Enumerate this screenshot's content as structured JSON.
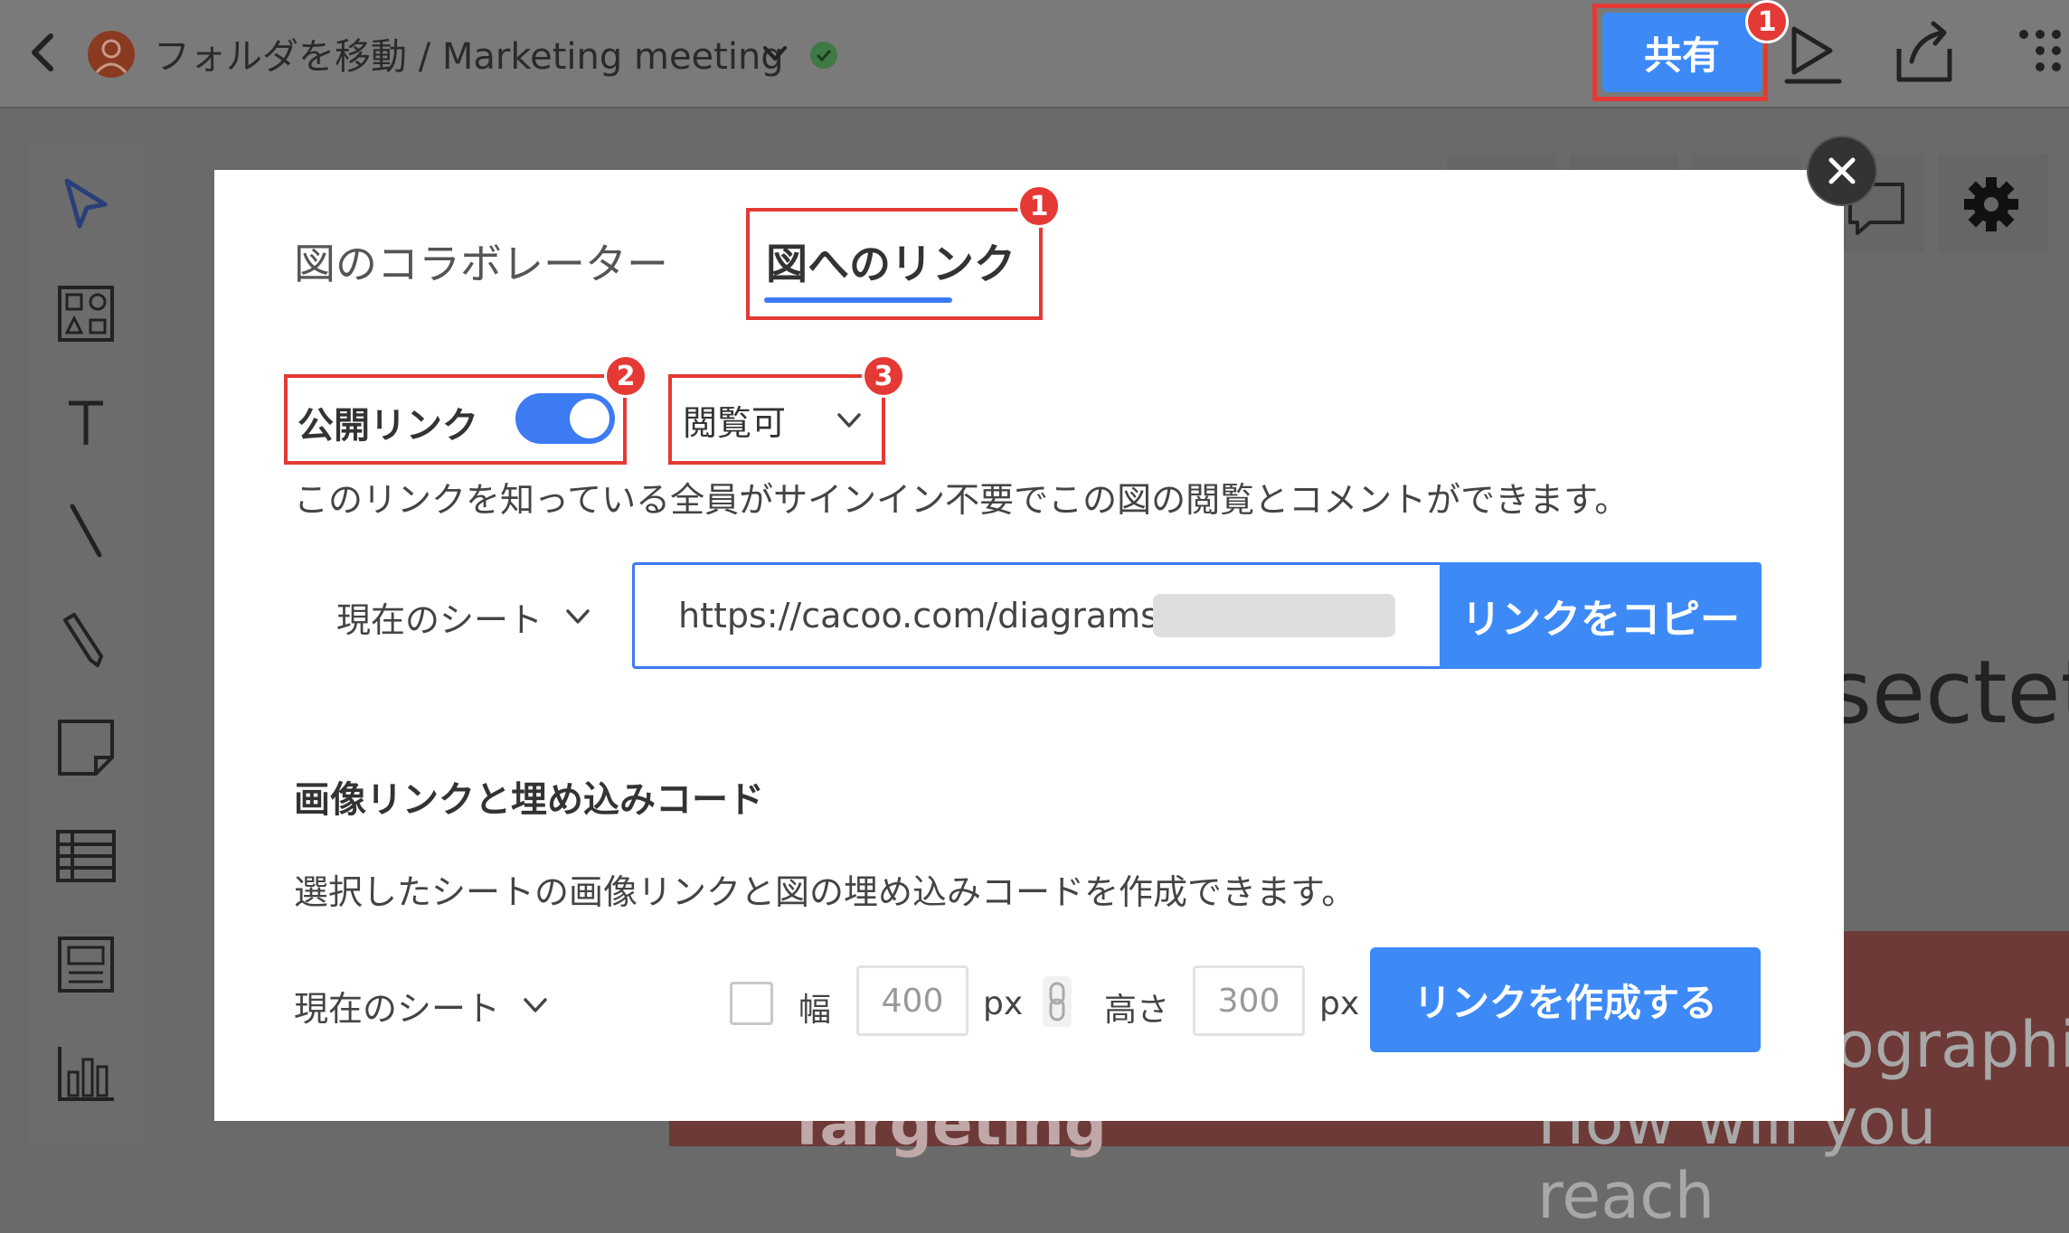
{
  "header": {
    "breadcrumb": "フォルダを移動 / Marketing meeting",
    "share_label": "共有"
  },
  "badges": {
    "one": "1",
    "two": "2",
    "three": "3"
  },
  "background": {
    "text_1": "sectet",
    "text_2": "ographic",
    "text_3": "How will you reach",
    "text_4": "Targeting"
  },
  "dialog": {
    "tabs": {
      "collaborators": "図のコラボレーター",
      "link": "図へのリンク"
    },
    "public_link": {
      "label": "公開リンク",
      "enabled": true,
      "permission": "閲覧可",
      "description": "このリンクを知っている全員がサインイン不要でこの図の閲覧とコメントができます。",
      "sheet": "現在のシート",
      "url": "https://cacoo.com/diagrams/",
      "copy_label": "リンクをコピー"
    },
    "embed": {
      "heading": "画像リンクと埋め込みコード",
      "description": "選択したシートの画像リンクと図の埋め込みコードを作成できます。",
      "sheet": "現在のシート",
      "width_label": "幅",
      "width_value": "400",
      "height_label": "高さ",
      "height_value": "300",
      "unit": "px",
      "create_label": "リンクを作成する"
    }
  },
  "colors": {
    "accent": "#3d8af7",
    "highlight": "#e53935"
  }
}
